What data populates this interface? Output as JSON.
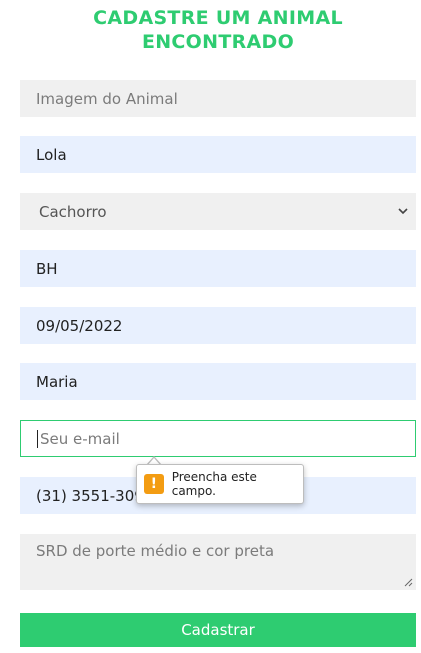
{
  "form": {
    "title_line1": "CADASTRE UM ANIMAL",
    "title_line2": "ENCONTRADO",
    "image_placeholder": "Imagem do Animal",
    "name_value": "Lola",
    "species_value": "Cachorro",
    "city_value": "BH",
    "date_value": "09/05/2022",
    "owner_value": "Maria",
    "email_placeholder": "Seu e-mail",
    "phone_value": "(31) 3551-3099",
    "description_placeholder": "SRD de porte médio e cor preta",
    "submit_label": "Cadastrar"
  },
  "tooltip": {
    "message": "Preencha este campo.",
    "icon": "warning-icon"
  },
  "colors": {
    "accent": "#2ecc71",
    "autofill_bg": "#e8f0fe",
    "field_bg": "#f0f0f0",
    "warning": "#f39c12"
  }
}
